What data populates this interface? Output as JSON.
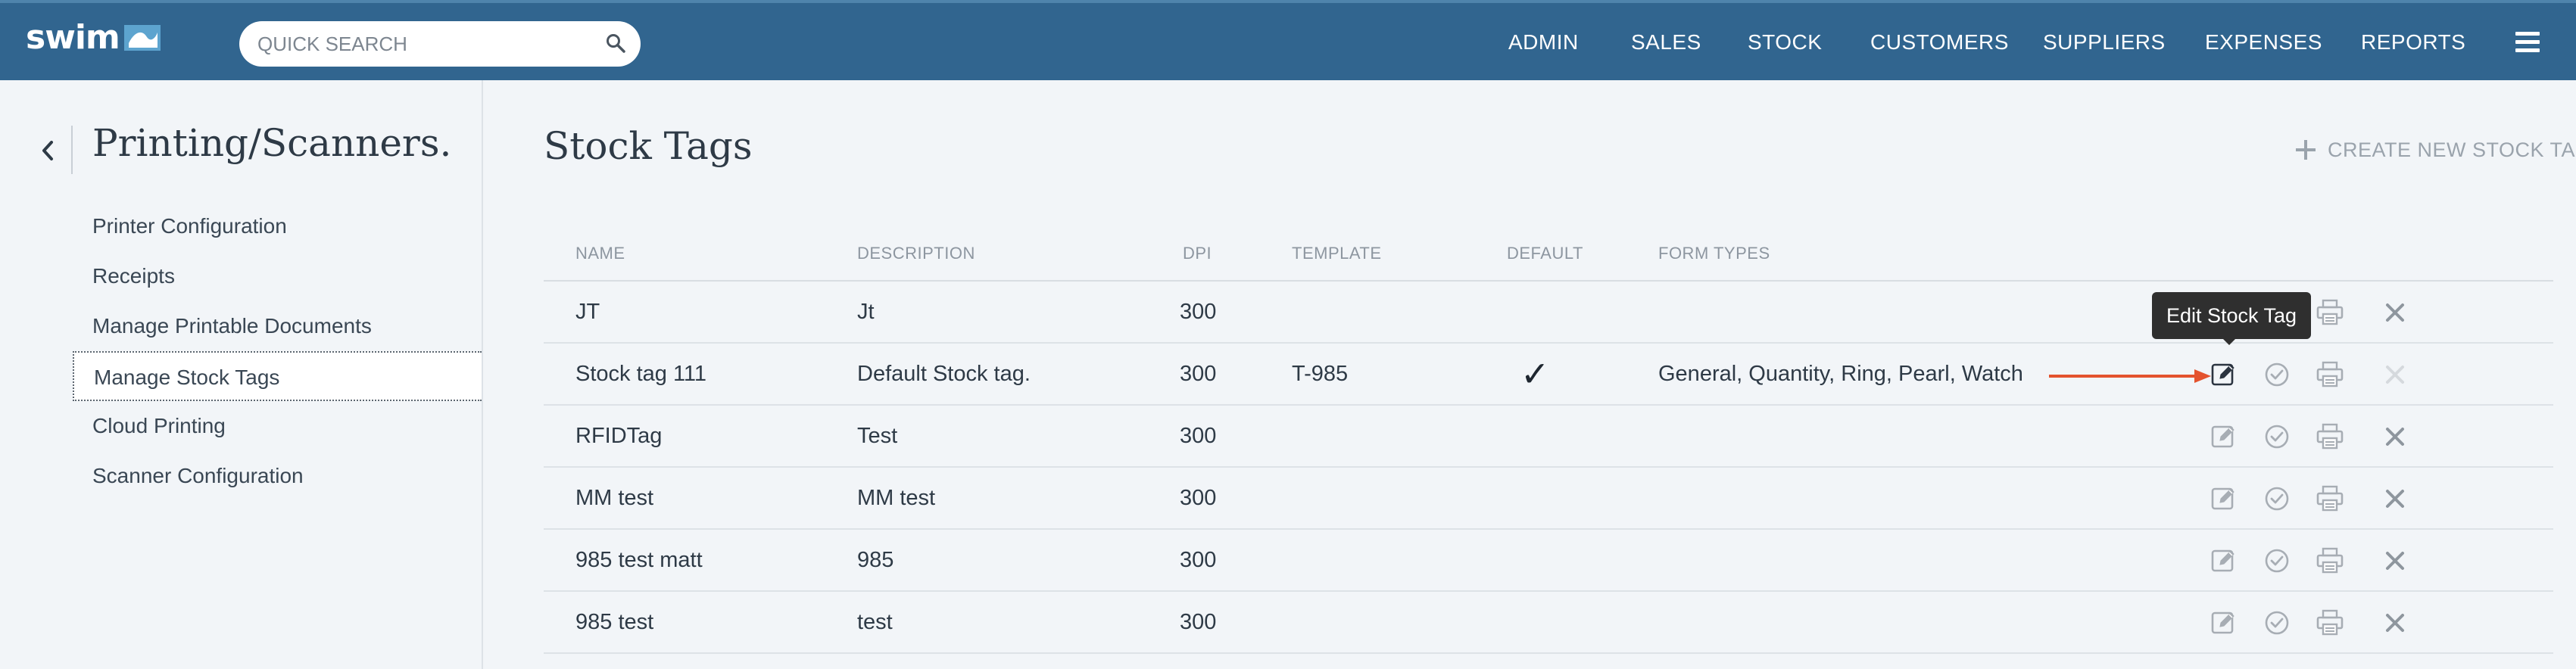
{
  "app": {
    "logo_text": "swim",
    "search": {
      "placeholder": "QUICK SEARCH",
      "value": ""
    },
    "nav": [
      "ADMIN",
      "SALES",
      "STOCK",
      "CUSTOMERS",
      "SUPPLIERS",
      "EXPENSES",
      "REPORTS"
    ]
  },
  "sidebar": {
    "title": "Printing/Scanners.",
    "items": [
      {
        "label": "Printer Configuration",
        "active": false
      },
      {
        "label": "Receipts",
        "active": false
      },
      {
        "label": "Manage Printable Documents",
        "active": false
      },
      {
        "label": "Manage Stock Tags",
        "active": true
      },
      {
        "label": "Cloud Printing",
        "active": false
      },
      {
        "label": "Scanner Configuration",
        "active": false
      }
    ]
  },
  "main": {
    "title": "Stock Tags",
    "create_label": "CREATE NEW STOCK TAG",
    "columns": [
      "NAME",
      "DESCRIPTION",
      "DPI",
      "TEMPLATE",
      "DEFAULT",
      "FORM TYPES"
    ],
    "rows": [
      {
        "name": "JT",
        "description": "Jt",
        "dpi": "300",
        "template": "",
        "default": "",
        "form_types": ""
      },
      {
        "name": "Stock tag 111",
        "description": "Default Stock tag.",
        "dpi": "300",
        "template": "T-985",
        "default": "✓",
        "form_types": "General, Quantity, Ring, Pearl, Watch"
      },
      {
        "name": "RFIDTag",
        "description": "Test",
        "dpi": "300",
        "template": "",
        "default": "",
        "form_types": ""
      },
      {
        "name": "MM test",
        "description": "MM test",
        "dpi": "300",
        "template": "",
        "default": "",
        "form_types": ""
      },
      {
        "name": "985 test matt",
        "description": "985",
        "dpi": "300",
        "template": "",
        "default": "",
        "form_types": ""
      },
      {
        "name": "985 test",
        "description": "test",
        "dpi": "300",
        "template": "",
        "default": "",
        "form_types": ""
      }
    ],
    "tooltip": "Edit Stock Tag"
  },
  "colors": {
    "topbar": "#31658f",
    "annotation_arrow": "#e4532e",
    "icon_gray": "#a7adb4",
    "icon_dark": "#2b3440"
  },
  "icons": {
    "edit": "edit-icon",
    "set_default": "check-circle-icon",
    "print": "printer-icon",
    "delete": "close-icon"
  }
}
